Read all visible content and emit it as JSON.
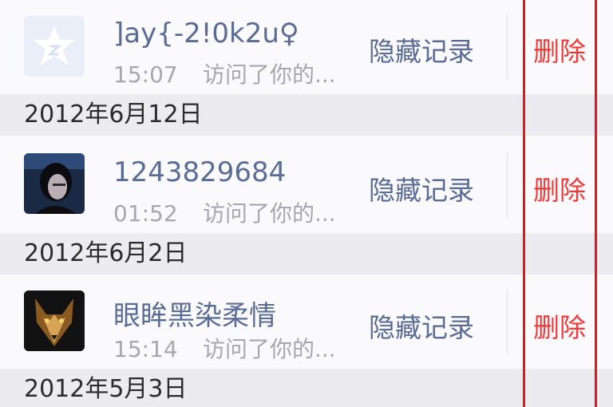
{
  "entries": [
    {
      "name": "]ay{-2!0k2u♀",
      "time": "15:07",
      "desc": "访问了你的...",
      "hide_label": "隐藏记录",
      "delete_label": "删除"
    },
    {
      "name": "1243829684",
      "time": "01:52",
      "desc": "访问了你的...",
      "hide_label": "隐藏记录",
      "delete_label": "删除"
    },
    {
      "name": "眼眸黑染柔情",
      "time": "15:14",
      "desc": "访问了你的...",
      "hide_label": "隐藏记录",
      "delete_label": "删除"
    }
  ],
  "date_headers": [
    "2012年6月12日",
    "2012年6月2日",
    "2012年5月3日"
  ],
  "colors": {
    "highlight_frame": "#e8141a",
    "delete_text": "#f03a3a",
    "link_text": "#5b6c94",
    "secondary_text": "#a7a7ad"
  },
  "icons": [
    "star-avatar-icon",
    "person-avatar",
    "wolf-avatar"
  ]
}
